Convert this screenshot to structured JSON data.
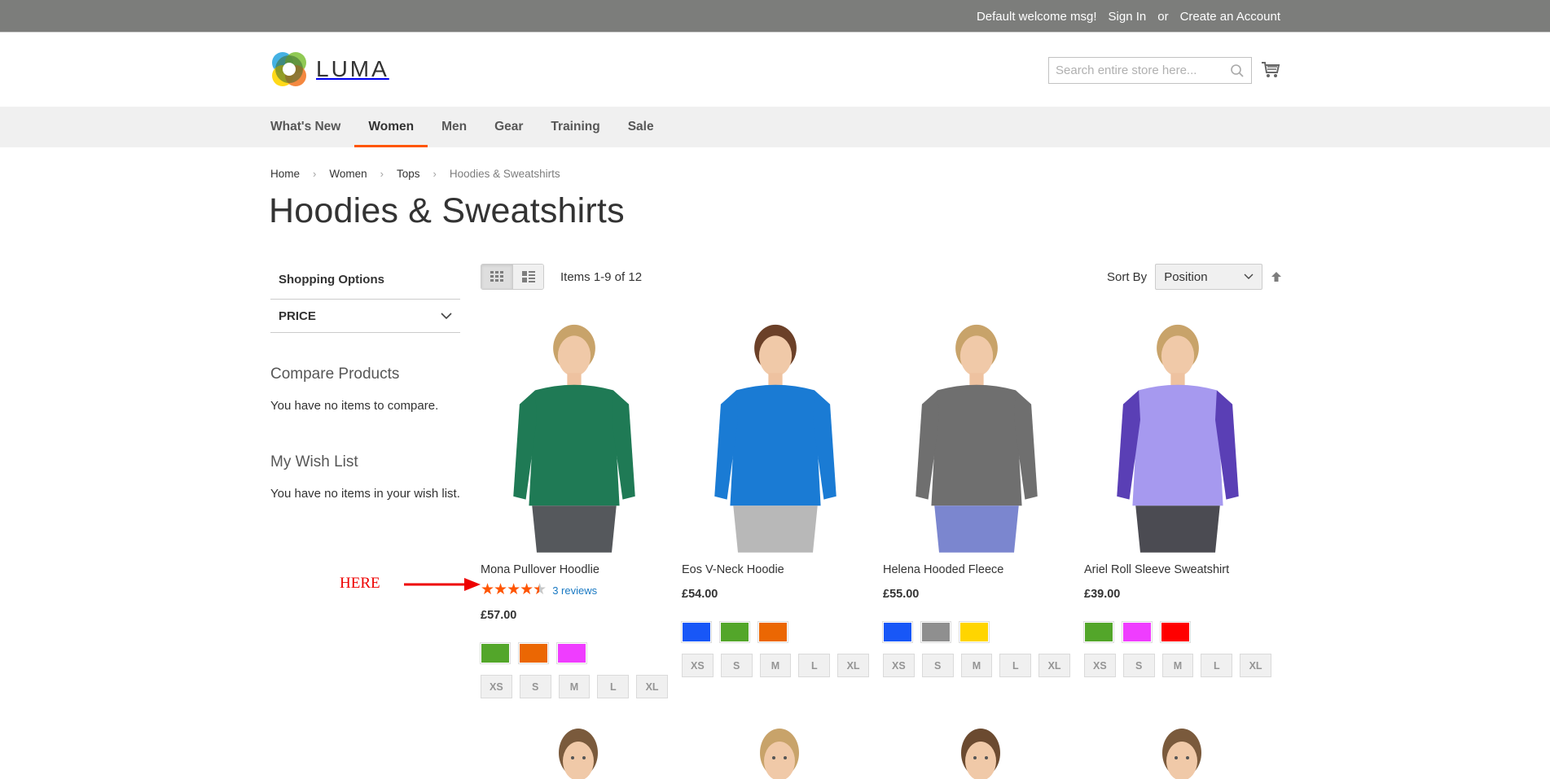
{
  "topbar": {
    "welcome": "Default welcome msg!",
    "sign_in": "Sign In",
    "or": "or",
    "create_account": "Create an Account"
  },
  "header": {
    "logo_text": "LUMA",
    "search_placeholder": "Search entire store here...",
    "search_icon": "search-icon",
    "cart_icon": "shopping-cart-icon"
  },
  "nav": {
    "items": [
      {
        "label": "What's New",
        "active": false
      },
      {
        "label": "Women",
        "active": true
      },
      {
        "label": "Men",
        "active": false
      },
      {
        "label": "Gear",
        "active": false
      },
      {
        "label": "Training",
        "active": false
      },
      {
        "label": "Sale",
        "active": false
      }
    ],
    "active_color": "#ff5501"
  },
  "breadcrumbs": [
    "Home",
    "Women",
    "Tops",
    "Hoodies & Sweatshirts"
  ],
  "page_title": "Hoodies & Sweatshirts",
  "sidebar": {
    "shopping_options": "Shopping Options",
    "filters": [
      {
        "label": "PRICE"
      }
    ],
    "compare_title": "Compare Products",
    "compare_text": "You have no items to compare.",
    "wishlist_title": "My Wish List",
    "wishlist_text": "You have no items in your wish list."
  },
  "toolbar": {
    "modes": [
      {
        "name": "grid",
        "active": true
      },
      {
        "name": "list",
        "active": false
      }
    ],
    "amount": "Items 1-9 of 12",
    "sort_label": "Sort By",
    "sort_value": "Position",
    "sort_direction_icon": "arrow-up-icon"
  },
  "products": [
    {
      "name": "Mona Pullover Hoodlie",
      "rating_stars": 4,
      "rating_half": true,
      "reviews": "3 reviews",
      "price": "£57.00",
      "swatches": [
        "#53a62a",
        "#eb6703",
        "#ef3dff"
      ],
      "sizes": [
        "XS",
        "S",
        "M",
        "L",
        "XL"
      ],
      "image": {
        "top": "#1f7a55",
        "bottom": "#55585c",
        "hair": "#c8a36a"
      }
    },
    {
      "name": "Eos V-Neck Hoodie",
      "price": "£54.00",
      "swatches": [
        "#1857f7",
        "#53a62a",
        "#eb6703"
      ],
      "sizes": [
        "XS",
        "S",
        "M",
        "L",
        "XL"
      ],
      "image": {
        "top": "#1a7bd4",
        "bottom": "#b8b8b8",
        "hair": "#6b4028"
      }
    },
    {
      "name": "Helena Hooded Fleece",
      "price": "£55.00",
      "swatches": [
        "#1857f7",
        "#8f8f8f",
        "#ffd500"
      ],
      "sizes": [
        "XS",
        "S",
        "M",
        "L",
        "XL"
      ],
      "image": {
        "top": "#6f6f6f",
        "bottom": "#7b86cf",
        "hair": "#c8a36a"
      }
    },
    {
      "name": "Ariel Roll Sleeve Sweatshirt",
      "price": "£39.00",
      "swatches": [
        "#53a62a",
        "#ef3dff",
        "#ff0000"
      ],
      "sizes": [
        "XS",
        "S",
        "M",
        "L",
        "XL"
      ],
      "image": {
        "top": "#a699ef",
        "bottom": "#4b4b52",
        "hair": "#c8a36a",
        "sleeves": "#5a3fb5"
      }
    }
  ],
  "row2_hair": [
    "#7a5a3c",
    "#c8a36a",
    "#6b4a30",
    "#7a5a3c"
  ],
  "annotation": {
    "text": "HERE",
    "color": "#ee0000"
  }
}
